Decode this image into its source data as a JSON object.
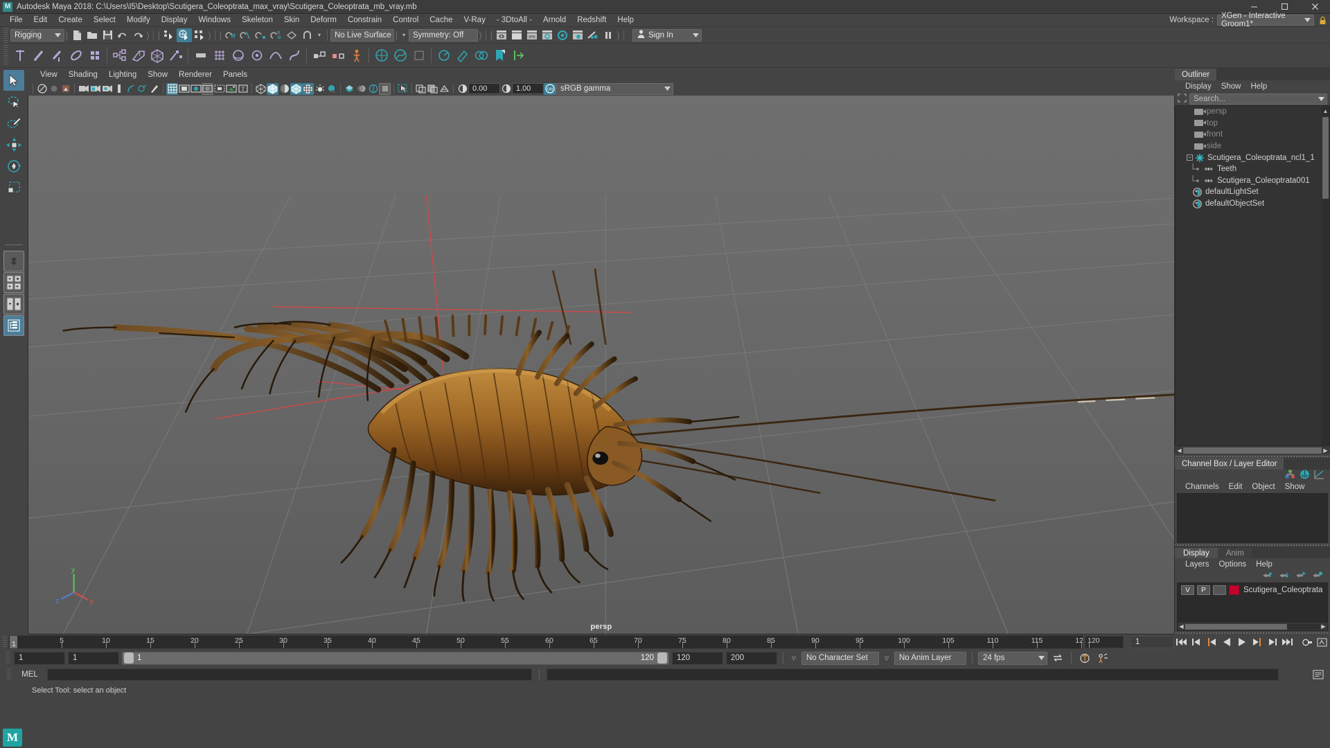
{
  "window": {
    "title": "Autodesk Maya 2018: C:\\Users\\I5\\Desktop\\Scutigera_Coleoptrata_max_vray\\Scutigera_Coleoptrata_mb_vray.mb",
    "logo_letter": "M",
    "minimize": "─",
    "maximize": "☐",
    "close": "✕"
  },
  "menubar": {
    "items": [
      {
        "label": "File"
      },
      {
        "label": "Edit"
      },
      {
        "label": "Create"
      },
      {
        "label": "Select"
      },
      {
        "label": "Modify"
      },
      {
        "label": "Display"
      },
      {
        "label": "Windows"
      },
      {
        "label": "Skeleton"
      },
      {
        "label": "Skin"
      },
      {
        "label": "Deform"
      },
      {
        "label": "Constrain"
      },
      {
        "label": "Control"
      },
      {
        "label": "Cache"
      },
      {
        "label": "V-Ray"
      },
      {
        "label": "- 3DtoAll -"
      },
      {
        "label": "Arnold"
      },
      {
        "label": "Redshift"
      },
      {
        "label": "Help"
      }
    ],
    "workspace_label": "Workspace :",
    "workspace_value": "XGen - Interactive Groom1*"
  },
  "statusline": {
    "menu_set": "Rigging",
    "live_surface": "No Live Surface",
    "symmetry": "Symmetry: Off",
    "sign_in": "Sign In"
  },
  "viewport_menu": {
    "items": [
      {
        "label": "View"
      },
      {
        "label": "Shading"
      },
      {
        "label": "Lighting"
      },
      {
        "label": "Show"
      },
      {
        "label": "Renderer"
      },
      {
        "label": "Panels"
      }
    ]
  },
  "viewport_toolbar": {
    "exposure": "0.00",
    "gamma": "1.00",
    "color_space": "sRGB gamma"
  },
  "viewport": {
    "camera_label": "persp",
    "background_top": "#6b6b6b",
    "background_bottom": "#5d5d5d",
    "axis": {
      "x": "x",
      "y": "y",
      "z": "z"
    }
  },
  "outliner": {
    "tab": "Outliner",
    "menus": [
      {
        "label": "Display"
      },
      {
        "label": "Show"
      },
      {
        "label": "Help"
      }
    ],
    "search_placeholder": "Search...",
    "items": [
      {
        "label": "persp",
        "type": "camera",
        "dim": true,
        "indent": 1
      },
      {
        "label": "top",
        "type": "camera",
        "dim": true,
        "indent": 1
      },
      {
        "label": "front",
        "type": "camera",
        "dim": true,
        "indent": 1
      },
      {
        "label": "side",
        "type": "camera",
        "dim": true,
        "indent": 1
      },
      {
        "label": "Scutigera_Coleoptrata_ncl1_1",
        "type": "group",
        "dim": false,
        "indent": 0
      },
      {
        "label": "Teeth",
        "type": "mesh",
        "dim": false,
        "indent": 2
      },
      {
        "label": "Scutigera_Coleoptrata001",
        "type": "mesh",
        "dim": false,
        "indent": 2
      },
      {
        "label": "defaultLightSet",
        "type": "set",
        "dim": false,
        "indent": 1
      },
      {
        "label": "defaultObjectSet",
        "type": "set",
        "dim": false,
        "indent": 1
      }
    ]
  },
  "channelbox": {
    "tab": "Channel Box / Layer Editor",
    "menus": [
      {
        "label": "Channels"
      },
      {
        "label": "Edit"
      },
      {
        "label": "Object"
      },
      {
        "label": "Show"
      }
    ]
  },
  "layer_editor": {
    "tabs": [
      {
        "label": "Display",
        "active": true
      },
      {
        "label": "Anim",
        "active": false
      }
    ],
    "menus": [
      {
        "label": "Layers"
      },
      {
        "label": "Options"
      },
      {
        "label": "Help"
      }
    ],
    "layers": [
      {
        "visibility": "V",
        "playback": "P",
        "shading": "",
        "color": "#c4002b",
        "name": "Scutigera_Coleoptrata"
      }
    ]
  },
  "timeslider": {
    "current_frame_marker": "1",
    "end_label": "120",
    "current_frame_field": "1",
    "ticks": [
      5,
      10,
      15,
      20,
      25,
      30,
      35,
      40,
      45,
      50,
      55,
      60,
      65,
      70,
      75,
      80,
      85,
      90,
      95,
      100,
      105,
      110,
      115,
      120
    ],
    "range_start": 1,
    "range_end": 120
  },
  "rangeslider": {
    "anim_start": "1",
    "playback_start": "1",
    "bar_start_label": "1",
    "bar_end_label": "120",
    "playback_end": "120",
    "anim_end": "200",
    "character_set": "No Character Set",
    "anim_layer": "No Anim Layer",
    "fps": "24 fps"
  },
  "command_line": {
    "language": "MEL",
    "input_value": ""
  },
  "status_bar": {
    "message": "Select Tool: select an object"
  },
  "colors": {
    "accent": "#3f7f96",
    "teal": "#2fa6b5",
    "orange": "#d98a34",
    "layer_red": "#c4002b",
    "panel_bg": "#444444",
    "dark_bg": "#2b2b2b"
  }
}
